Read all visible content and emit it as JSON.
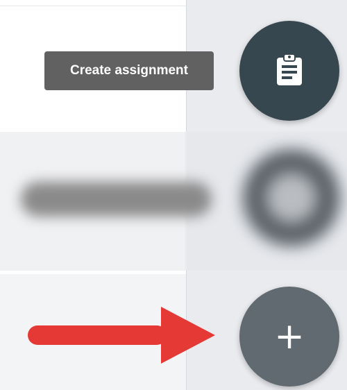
{
  "tooltip": {
    "text": "Create assignment"
  },
  "fab_assignment": {
    "icon": "clipboard-icon",
    "color": "#37474f"
  },
  "fab_add": {
    "label": "+",
    "icon": "plus-icon",
    "color": "#616a71"
  },
  "annotation": {
    "icon": "red-arrow-icon",
    "color": "#e53935"
  },
  "colors": {
    "panel_background": "#e9ebef",
    "tooltip_background": "#616161"
  }
}
